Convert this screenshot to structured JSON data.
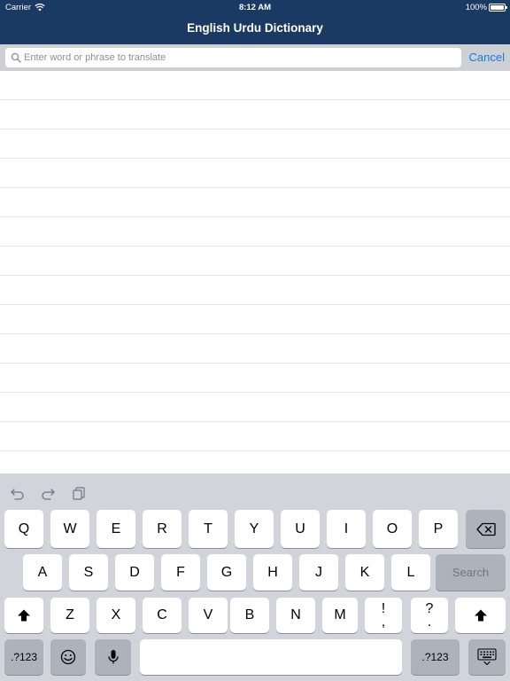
{
  "status_bar": {
    "carrier": "Carrier",
    "time": "8:12 AM",
    "battery": "100%"
  },
  "nav": {
    "title": "English Urdu Dictionary"
  },
  "search": {
    "placeholder": "Enter word or phrase to translate",
    "value": "",
    "cancel_label": "Cancel"
  },
  "results": {
    "row_count": 14
  },
  "keyboard": {
    "row1": [
      "Q",
      "W",
      "E",
      "R",
      "T",
      "Y",
      "U",
      "I",
      "O",
      "P"
    ],
    "row2": [
      "A",
      "S",
      "D",
      "F",
      "G",
      "H",
      "J",
      "K",
      "L"
    ],
    "row3": [
      "Z",
      "X",
      "C",
      "V",
      "B",
      "N",
      "M"
    ],
    "punct1": {
      "top": "!",
      "bottom": ","
    },
    "punct2": {
      "top": "?",
      "bottom": "."
    },
    "search_label": "Search",
    "numbers_label": ".?123"
  },
  "colors": {
    "header_bg": "#1a3a63",
    "accent": "#1a7ae0",
    "keyboard_bg": "#d1d5db"
  }
}
